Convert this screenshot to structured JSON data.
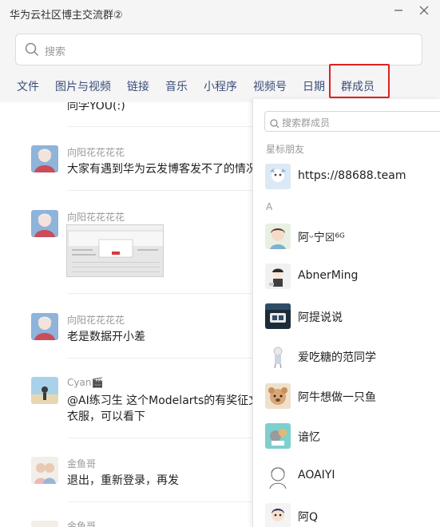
{
  "window": {
    "title": "华为云社区博主交流群②",
    "minimize_icon": "minimize-icon",
    "close_icon": "close-icon"
  },
  "search": {
    "placeholder": "搜索",
    "icon": "search-icon"
  },
  "tabs": [
    {
      "label": "文件"
    },
    {
      "label": "图片与视频"
    },
    {
      "label": "链接"
    },
    {
      "label": "音乐"
    },
    {
      "label": "小程序"
    },
    {
      "label": "视频号"
    },
    {
      "label": "日期"
    },
    {
      "label": "群成员",
      "active": true
    }
  ],
  "messages": [
    {
      "text": "同学YOU(:)"
    },
    {
      "sender": "向阳花花花花",
      "text": "大家有遇到华为云发博客发不了的情况"
    },
    {
      "sender": "向阳花花花花",
      "type": "image"
    },
    {
      "sender": "向阳花花花花",
      "text": "老是数据开小差"
    },
    {
      "sender": "Cyan🎬",
      "text": "@AI练习生 这个Modelarts的有奖征文",
      "text2": "衣服，可以看下"
    },
    {
      "sender": "金鱼哥",
      "text": "退出，重新登录，再发"
    },
    {
      "sender": "金鱼哥"
    }
  ],
  "members_panel": {
    "search_placeholder": "搜索群成员",
    "starred_label": "星标朋友",
    "starred": [
      {
        "name": "https://88688.team"
      }
    ],
    "group_a_label": "A",
    "members": [
      {
        "name": "阿ᵕ宁☒⁶ᴳ"
      },
      {
        "name": "AbnerMing"
      },
      {
        "name": "阿提说说"
      },
      {
        "name": "爱吃糖的范同学"
      },
      {
        "name": "阿牛想做一只鱼"
      },
      {
        "name": "谙忆"
      },
      {
        "name": "AOAIYI"
      },
      {
        "name": "阿Q"
      }
    ]
  },
  "colors": {
    "titlebar_bg": "#f5f5f5",
    "tab_text": "#3b4d7a",
    "highlight_box": "#e02020",
    "secondary_text": "#999999"
  }
}
